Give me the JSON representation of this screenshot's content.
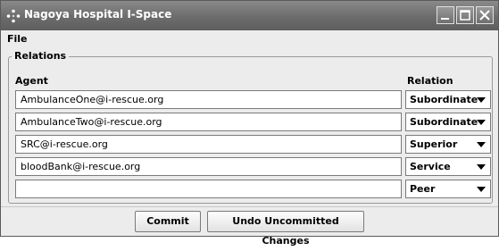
{
  "window": {
    "title": "Nagoya Hospital I-Space"
  },
  "menu": {
    "file_label": "File"
  },
  "relations": {
    "legend": "Relations",
    "agent_header": "Agent",
    "relation_header": "Relation",
    "rows": [
      {
        "agent": "AmbulanceOne@i-rescue.org",
        "relation": "Subordinate"
      },
      {
        "agent": "AmbulanceTwo@i-rescue.org",
        "relation": "Subordinate"
      },
      {
        "agent": "SRC@i-rescue.org",
        "relation": "Superior"
      },
      {
        "agent": "bloodBank@i-rescue.org",
        "relation": "Service"
      },
      {
        "agent": "",
        "relation": "Peer"
      }
    ]
  },
  "buttons": {
    "commit_label": "Commit",
    "undo_label": "Undo Uncommitted Changes"
  },
  "icons": {
    "app": "app-diamond-icon",
    "minimize": "minimize-icon",
    "maximize": "maximize-icon",
    "close": "close-icon",
    "dropdown": "chevron-down-icon"
  },
  "colors": {
    "titlebar": "#6c6c6c",
    "background": "#ececec"
  }
}
